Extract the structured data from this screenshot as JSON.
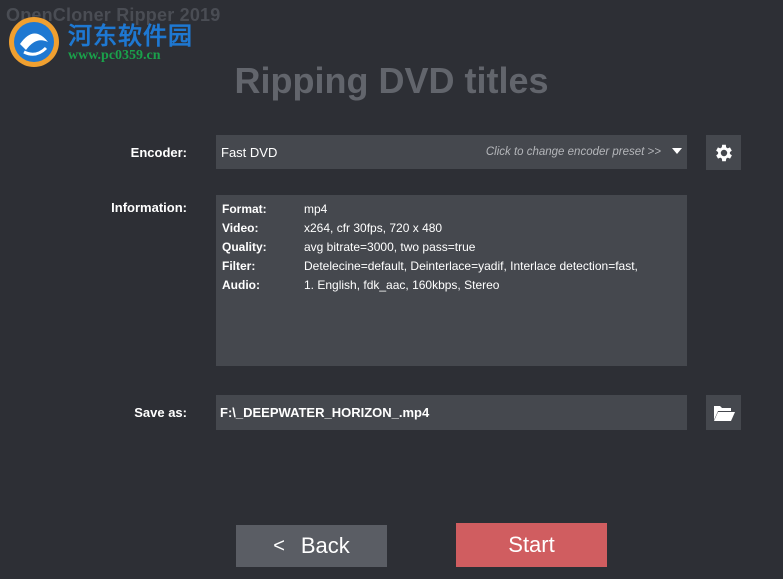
{
  "app": {
    "title": "OpenCloner Ripper 2019"
  },
  "watermark": {
    "cn_text": "河东软件园",
    "url": "www.pc0359.cn"
  },
  "page": {
    "title": "Ripping DVD titles"
  },
  "encoder": {
    "label": "Encoder:",
    "value": "Fast DVD",
    "hint": "Click to change encoder preset >>",
    "settings_icon": "gear-icon"
  },
  "information": {
    "label": "Information:",
    "rows": [
      {
        "key": "Format:",
        "value": "mp4"
      },
      {
        "key": "Video:",
        "value": "x264, cfr 30fps, 720 x 480"
      },
      {
        "key": "Quality:",
        "value": "avg bitrate=3000, two pass=true"
      },
      {
        "key": "Filter:",
        "value": "Detelecine=default, Deinterlace=yadif, Interlace detection=fast,"
      },
      {
        "key": "Audio:",
        "value": "1. English, fdk_aac, 160kbps, Stereo"
      }
    ]
  },
  "save_as": {
    "label": "Save as:",
    "value": "F:\\_DEEPWATER_HORIZON_.mp4",
    "browse_icon": "folder-open-icon"
  },
  "buttons": {
    "back_arrow": "<",
    "back": "Back",
    "start": "Start"
  },
  "colors": {
    "background": "#2d2f35",
    "field": "#45484e",
    "start": "#d05d60",
    "back": "#5a5d64",
    "title": "#62656c"
  }
}
